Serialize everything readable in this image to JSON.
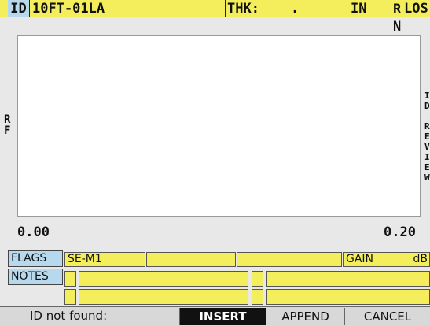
{
  "header": {
    "id_label": "ID",
    "id_value": "10FT-01LA",
    "thk_label": "THK:",
    "thk_value": ".",
    "thk_unit": "IN",
    "rn_icon": "R\nN",
    "right_text": "LOS"
  },
  "waveform": {
    "rf_label": "R\nF",
    "right_labels": [
      "I",
      "D",
      "",
      "R",
      "E",
      "V",
      "I",
      "E",
      "W"
    ],
    "x_min": "0.00",
    "x_max": "0.20"
  },
  "flags": {
    "label": "FLAGS",
    "cell1": "SE-M1",
    "cell2": "",
    "cell3": "",
    "gain_label": "GAIN",
    "gain_unit": "dB"
  },
  "notes": {
    "label": "NOTES"
  },
  "status": {
    "message": "ID not found:",
    "insert": "INSERT",
    "append": "APPEND",
    "cancel": "CANCEL"
  }
}
